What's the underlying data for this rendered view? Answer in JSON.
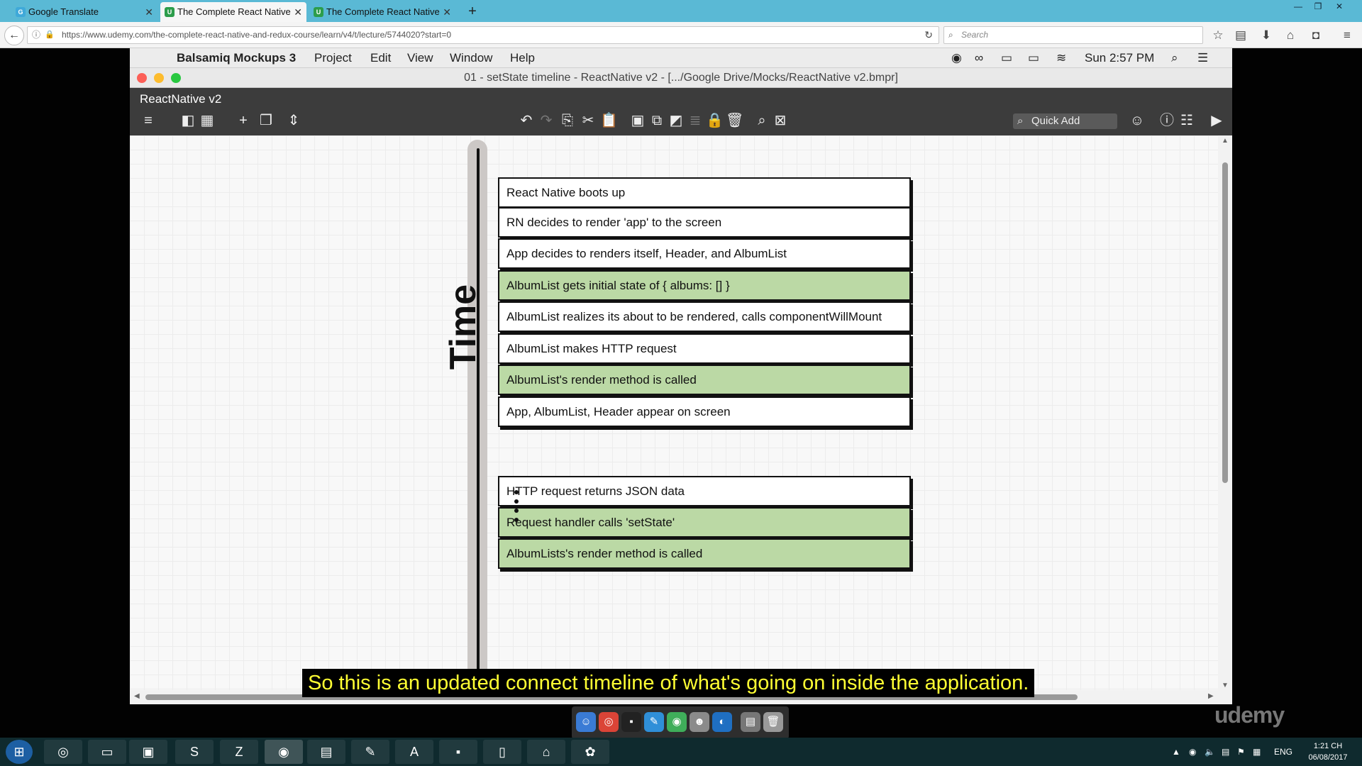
{
  "browser": {
    "tabs": [
      {
        "label": "Google Translate",
        "favicon": "google-translate-icon",
        "active": false
      },
      {
        "label": "The Complete React Native",
        "favicon": "udemy-icon",
        "active": true
      },
      {
        "label": "The Complete React Native",
        "favicon": "udemy-icon",
        "active": false
      }
    ],
    "url": "https://www.udemy.com/the-complete-react-native-and-redux-course/learn/v4/t/lecture/5744020?start=0",
    "search_placeholder": "Search"
  },
  "mac": {
    "app_name": "Balsamiq Mockups 3",
    "menus": [
      "Project",
      "Edit",
      "View",
      "Window",
      "Help"
    ],
    "clock": "Sun 2:57 PM",
    "window_title": "01 - setState timeline - ReactNative v2 - [.../Google Drive/Mocks/ReactNative v2.bmpr]",
    "project_name": "ReactNative v2",
    "quick_add": "Quick Add"
  },
  "timeline": {
    "axis_label": "Time",
    "steps": [
      {
        "text": "React Native boots up",
        "color": "white"
      },
      {
        "text": "RN decides to render 'app' to the screen",
        "color": "white"
      },
      {
        "text": "App decides to renders itself, Header, and AlbumList",
        "color": "white"
      },
      {
        "text": "AlbumList gets initial state of { albums: [] }",
        "color": "green"
      },
      {
        "text": "AlbumList realizes its about to be rendered, calls componentWillMount",
        "color": "white"
      },
      {
        "text": "AlbumList makes HTTP request",
        "color": "white"
      },
      {
        "text": "AlbumList's render method is called",
        "color": "green"
      },
      {
        "text": "App, AlbumList, Header appear on screen",
        "color": "white"
      },
      {
        "text": "HTTP request returns JSON data",
        "color": "white"
      },
      {
        "text": "Request handler calls 'setState'",
        "color": "green"
      },
      {
        "text": "AlbumLists's render method is called",
        "color": "green"
      }
    ],
    "colors": {
      "white": "#ffffff",
      "green": "#bbd9a5"
    }
  },
  "subtitle": "So this is an updated connect timeline of what's going on inside the application.",
  "watermark": "udemy",
  "taskbar": {
    "language": "ENG",
    "time": "1:21 CH",
    "date": "06/08/2017"
  }
}
